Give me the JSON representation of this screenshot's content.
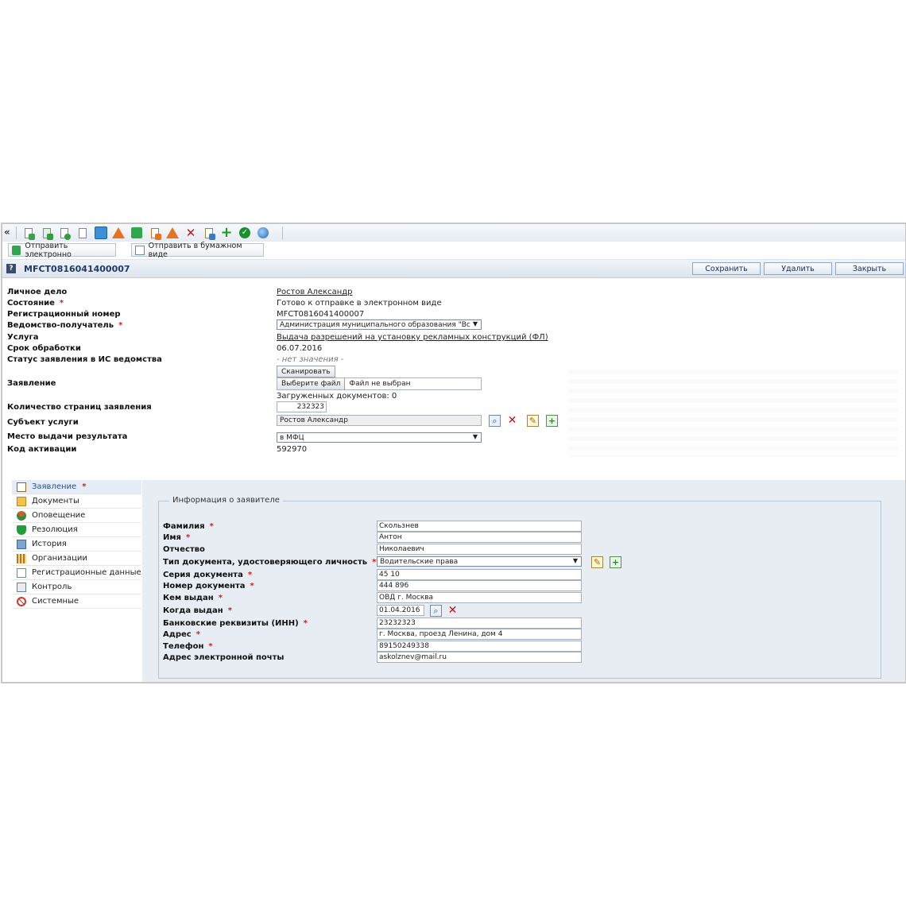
{
  "toolbar": {
    "collapse_label": "«",
    "icons": [
      "add-document-icon",
      "add-green-document-icon",
      "approve-document-icon",
      "blank-document-icon",
      "grid-icon",
      "warning-icon",
      "green-arrow-icon",
      "orange-document-icon",
      "warning-icon",
      "delete-icon",
      "edit-icon",
      "add-icon",
      "check-icon",
      "globe-icon"
    ]
  },
  "actions": {
    "send_electronic": "Отправить электронно",
    "send_paper": "Отправить в бумажном виде"
  },
  "header": {
    "help_label": "?",
    "title": "MFCT0816041400007",
    "save": "Сохранить",
    "delete": "Удалить",
    "close": "Закрыть"
  },
  "form": {
    "personal_case": {
      "label": "Личное дело",
      "value": "Ростов Александр"
    },
    "state": {
      "label": "Состояние",
      "value": "Готово к отправке в электронном виде"
    },
    "reg_number": {
      "label": "Регистрационный номер",
      "value": "MFCT0816041400007"
    },
    "agency": {
      "label": "Ведомство-получатель",
      "value": "Администрация муниципального образования \"Вс"
    },
    "service": {
      "label": "Услуга",
      "value": "Выдача разрешений на установку рекламных конструкций (ФЛ)"
    },
    "deadline": {
      "label": "Срок обработки",
      "value": "06.07.2016"
    },
    "is_status": {
      "label": "Статус заявления в ИС ведомства",
      "value": "- нет значения -"
    },
    "application": {
      "label": "Заявление",
      "scan": "Сканировать",
      "choose_file": "Выберите файл",
      "no_file": "Файл не выбран",
      "uploaded": "Загруженных документов: 0"
    },
    "pages": {
      "label": "Количество страниц заявления",
      "value": "232323"
    },
    "subject": {
      "label": "Субъект услуги",
      "value": "Ростов Александр"
    },
    "result_place": {
      "label": "Место выдачи результата",
      "value": "в МФЦ"
    },
    "activation": {
      "label": "Код активации",
      "value": "592970"
    }
  },
  "required_mark": "*",
  "nav": {
    "items": [
      {
        "label": "Заявление",
        "icon": "application-icon",
        "required": "*"
      },
      {
        "label": "Документы",
        "icon": "documents-icon"
      },
      {
        "label": "Оповещение",
        "icon": "notification-icon"
      },
      {
        "label": "Резолюция",
        "icon": "shield-icon"
      },
      {
        "label": "История",
        "icon": "history-icon"
      },
      {
        "label": "Организации",
        "icon": "organization-icon"
      },
      {
        "label": "Регистрационные данные",
        "icon": "registration-icon"
      },
      {
        "label": "Контроль",
        "icon": "control-icon"
      },
      {
        "label": "Системные",
        "icon": "system-icon"
      }
    ]
  },
  "applicant": {
    "legend": "Информация о заявителе",
    "fields": [
      {
        "label": "Фамилия",
        "value": "Скользнев",
        "required": true
      },
      {
        "label": "Имя",
        "value": "Антон",
        "required": true
      },
      {
        "label": "Отчество",
        "value": "Николаевич",
        "required": false
      },
      {
        "label": "Тип документа, удостоверяющего личность",
        "value": "Водительские права",
        "required": true
      },
      {
        "label": "Серия документа",
        "value": "45 10",
        "required": true
      },
      {
        "label": "Номер документа",
        "value": "444 896",
        "required": true
      },
      {
        "label": "Кем выдан",
        "value": "ОВД г. Москва",
        "required": true
      },
      {
        "label": "Когда выдан",
        "value": "01.04.2016",
        "required": true
      },
      {
        "label": "Банковские реквизиты (ИНН)",
        "value": "23232323",
        "required": true
      },
      {
        "label": "Адрес",
        "value": "г. Москва, проезд Ленина, дом 4",
        "required": true
      },
      {
        "label": "Телефон",
        "value": "89150249338",
        "required": true
      },
      {
        "label": "Адрес электронной почты",
        "value": "askolznev@mail.ru",
        "required": false
      }
    ]
  }
}
